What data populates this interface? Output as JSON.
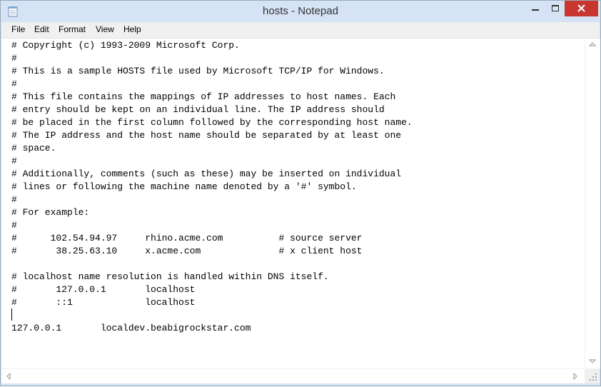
{
  "window": {
    "title": "hosts - Notepad"
  },
  "menu": {
    "file": "File",
    "edit": "Edit",
    "format": "Format",
    "view": "View",
    "help": "Help"
  },
  "editor": {
    "lines": [
      "# Copyright (c) 1993-2009 Microsoft Corp.",
      "#",
      "# This is a sample HOSTS file used by Microsoft TCP/IP for Windows.",
      "#",
      "# This file contains the mappings of IP addresses to host names. Each",
      "# entry should be kept on an individual line. The IP address should",
      "# be placed in the first column followed by the corresponding host name.",
      "# The IP address and the host name should be separated by at least one",
      "# space.",
      "#",
      "# Additionally, comments (such as these) may be inserted on individual",
      "# lines or following the machine name denoted by a '#' symbol.",
      "#",
      "# For example:",
      "#",
      "#      102.54.94.97     rhino.acme.com          # source server",
      "#       38.25.63.10     x.acme.com              # x client host",
      "",
      "# localhost name resolution is handled within DNS itself.",
      "#       127.0.0.1       localhost",
      "#       ::1             localhost",
      "",
      "127.0.0.1       localdev.beabigrockstar.com"
    ]
  },
  "colors": {
    "frame": "#d5e3f4",
    "close_button": "#c7372f",
    "menu_background": "#f0f0f0"
  },
  "icons": [
    "notepad-icon",
    "minimize-icon",
    "maximize-icon",
    "close-icon",
    "scroll-up-icon",
    "scroll-down-icon",
    "scroll-left-icon",
    "scroll-right-icon",
    "size-grip-icon"
  ]
}
